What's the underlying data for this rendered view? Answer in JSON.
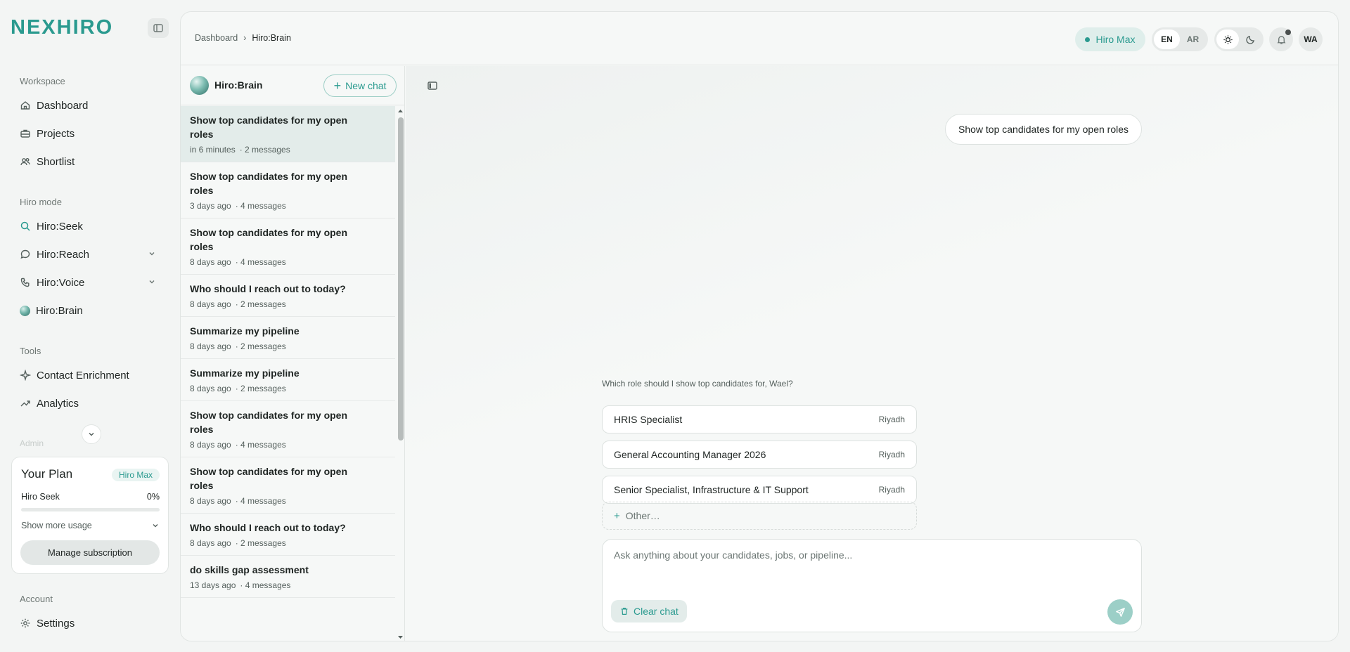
{
  "brand": {
    "logo": "NEXHIRO",
    "accent": "#2a9a8f"
  },
  "sidebar": {
    "workspace_label": "Workspace",
    "workspace_items": [
      {
        "label": "Dashboard",
        "icon": "home-icon"
      },
      {
        "label": "Projects",
        "icon": "briefcase-icon"
      },
      {
        "label": "Shortlist",
        "icon": "users-icon"
      }
    ],
    "mode_label": "Hiro mode",
    "mode_items": [
      {
        "label": "Hiro:Seek",
        "icon": "search-icon"
      },
      {
        "label": "Hiro:Reach",
        "icon": "message-icon"
      },
      {
        "label": "Hiro:Voice",
        "icon": "phone-icon"
      },
      {
        "label": "Hiro:Brain",
        "icon": "brain-orb-icon"
      }
    ],
    "tools_label": "Tools",
    "tools_items": [
      {
        "label": "Contact Enrichment",
        "icon": "sparkle-icon"
      },
      {
        "label": "Analytics",
        "icon": "trend-icon"
      }
    ],
    "faded_label": "Admin",
    "account_label": "Account",
    "account_items": [
      {
        "label": "Settings",
        "icon": "gear-icon"
      }
    ]
  },
  "plan": {
    "title": "Your Plan",
    "badge": "Hiro Max",
    "usage_label": "Hiro Seek",
    "usage_value": "0%",
    "usage_fraction": 0,
    "show_more": "Show more usage",
    "manage": "Manage subscription"
  },
  "header": {
    "breadcrumb": [
      "Dashboard",
      "Hiro:Brain"
    ],
    "plan_pill": "Hiro Max",
    "languages": [
      "EN",
      "AR"
    ],
    "active_language": "EN",
    "avatar_initials": "WA"
  },
  "chatlist": {
    "title": "Hiro:Brain",
    "new_chat": "New chat",
    "items": [
      {
        "title": "Show top candidates for my open roles",
        "time": "in 6 minutes",
        "count": "· 2 messages",
        "active": true
      },
      {
        "title": "Show top candidates for my open roles",
        "time": "3 days ago",
        "count": "· 4 messages"
      },
      {
        "title": "Show top candidates for my open roles",
        "time": "8 days ago",
        "count": "· 4 messages"
      },
      {
        "title": "Who should I reach out to today?",
        "time": "8 days ago",
        "count": "· 2 messages"
      },
      {
        "title": "Summarize my pipeline",
        "time": "8 days ago",
        "count": "· 2 messages"
      },
      {
        "title": "Summarize my pipeline",
        "time": "8 days ago",
        "count": "· 2 messages"
      },
      {
        "title": "Show top candidates for my open roles",
        "time": "8 days ago",
        "count": "· 4 messages"
      },
      {
        "title": "Show top candidates for my open roles",
        "time": "8 days ago",
        "count": "· 4 messages"
      },
      {
        "title": "Who should I reach out to today?",
        "time": "8 days ago",
        "count": "· 2 messages"
      },
      {
        "title": "do skills gap assessment",
        "time": "13 days ago",
        "count": "· 4 messages"
      }
    ]
  },
  "chat": {
    "user_message": "Show top candidates for my open roles",
    "question": "Which role should I show top candidates for, Wael?",
    "roles": [
      {
        "title": "HRIS Specialist",
        "location": "Riyadh"
      },
      {
        "title": "General Accounting Manager 2026",
        "location": "Riyadh"
      },
      {
        "title": "Senior Specialist, Infrastructure & IT Support",
        "location": "Riyadh"
      }
    ],
    "other": "Other…",
    "placeholder": "Ask anything about your candidates, jobs, or pipeline...",
    "clear": "Clear chat"
  }
}
